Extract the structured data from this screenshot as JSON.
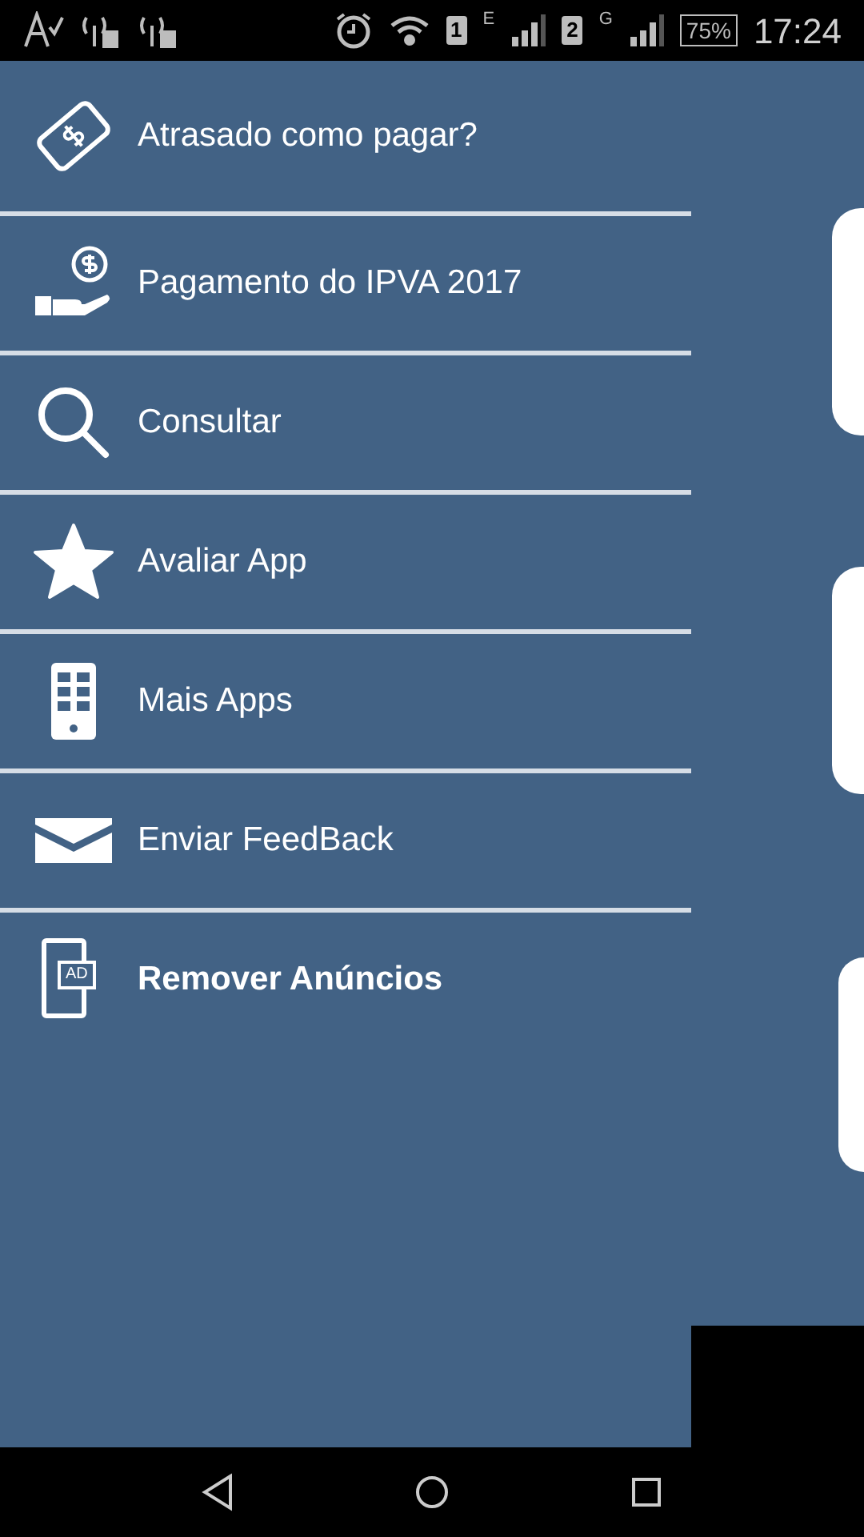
{
  "status_bar": {
    "sim1": "1",
    "network1": "E",
    "sim2": "2",
    "network2": "G",
    "battery": "75%",
    "time": "17:24"
  },
  "menu": [
    {
      "kind": "money",
      "label": "Atrasado como pagar?",
      "bold": false
    },
    {
      "kind": "pay",
      "label": "Pagamento do IPVA 2017",
      "bold": false
    },
    {
      "kind": "search",
      "label": "Consultar",
      "bold": false
    },
    {
      "kind": "star",
      "label": "Avaliar App",
      "bold": false
    },
    {
      "kind": "phone",
      "label": "Mais Apps",
      "bold": false
    },
    {
      "kind": "mail",
      "label": "Enviar FeedBack",
      "bold": false
    },
    {
      "kind": "ad",
      "label": "Remover Anúncios",
      "bold": true,
      "badge": "AD"
    }
  ]
}
